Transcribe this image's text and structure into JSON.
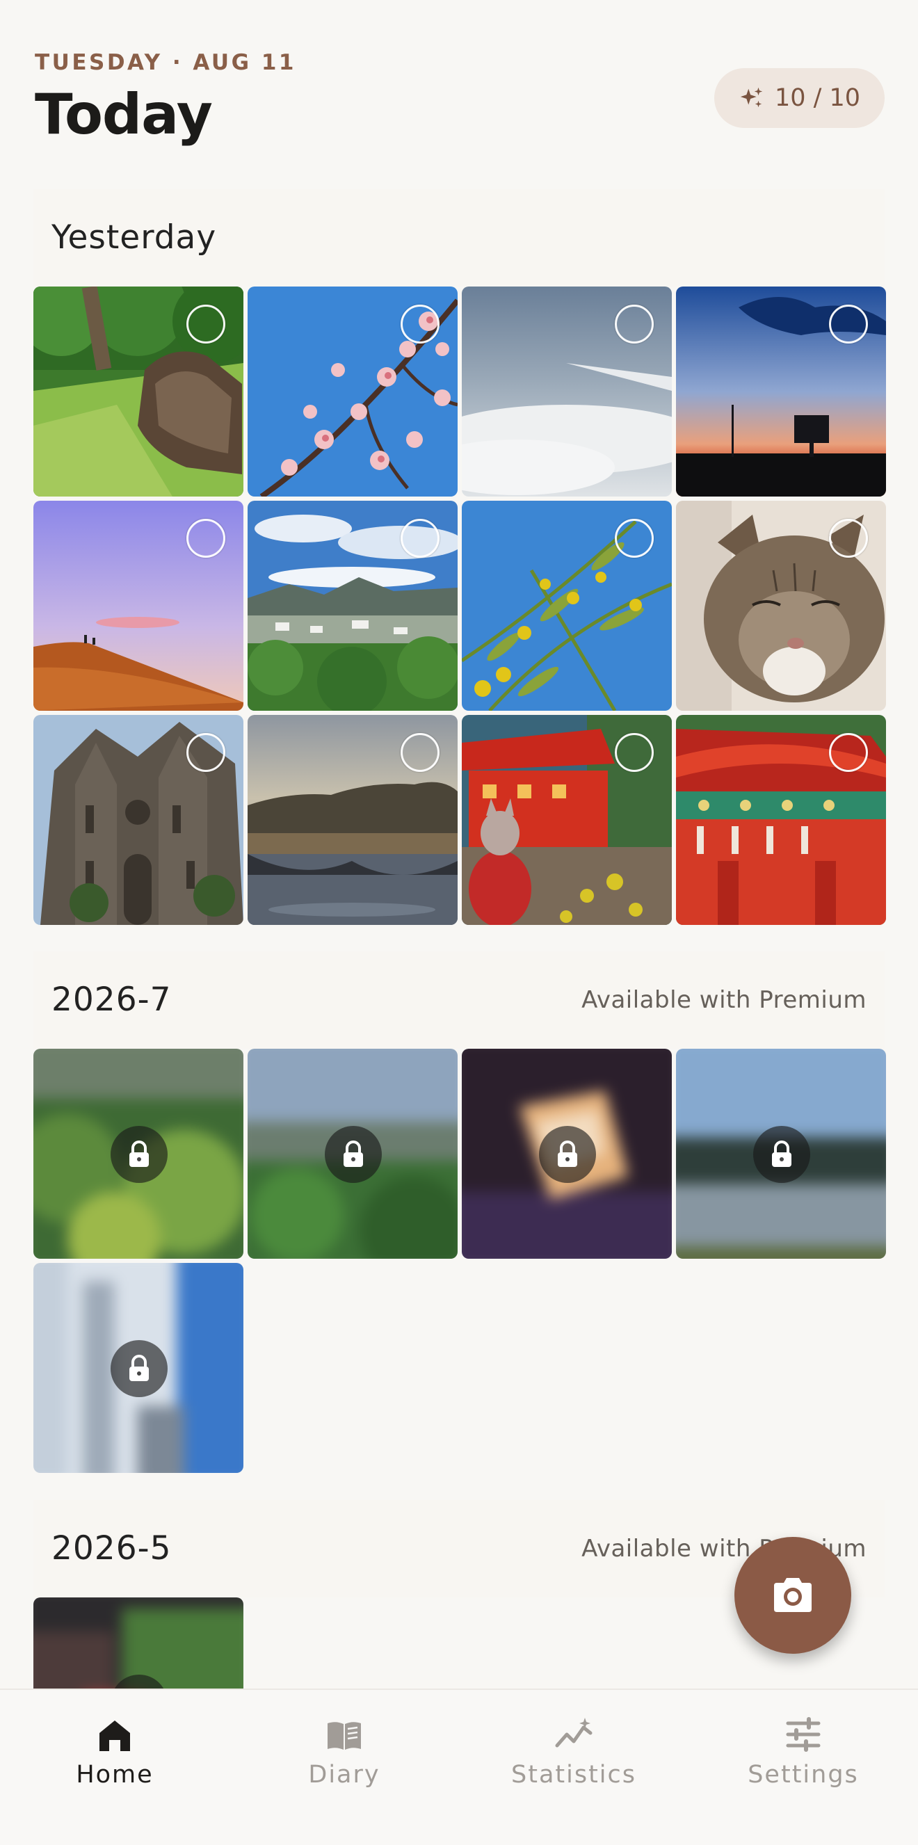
{
  "header": {
    "date": "TUESDAY · AUG 11",
    "title": "Today",
    "credits": "10 / 10",
    "credits_icon": "sparkle-icon"
  },
  "sections": [
    {
      "title": "Yesterday",
      "note": ""
    },
    {
      "title": "2026-7",
      "note": "Available with Premium"
    },
    {
      "title": "2026-5",
      "note": "Available with Premium"
    }
  ],
  "yesterday_photos": [
    "park-tree-stump",
    "cherry-blossom",
    "airplane-wing-clouds",
    "sunset-sky",
    "hill-silhouette",
    "town-valley",
    "yellow-flowers",
    "tabby-cat",
    "cathedral",
    "lake-reflection",
    "red-shrine-fox",
    "red-shrine-roof"
  ],
  "locked_photos_2026_7": [
    "lotus-leaves",
    "lotus-pond",
    "cake-slice",
    "lake-trees",
    "white-building"
  ],
  "locked_photos_2026_5": [
    "street-scene"
  ],
  "fab": {
    "icon": "camera-icon"
  },
  "nav": {
    "items": [
      {
        "label": "Home",
        "icon": "home-icon",
        "active": true
      },
      {
        "label": "Diary",
        "icon": "book-icon",
        "active": false
      },
      {
        "label": "Statistics",
        "icon": "chart-icon",
        "active": false
      },
      {
        "label": "Settings",
        "icon": "sliders-icon",
        "active": false
      }
    ]
  },
  "colors": {
    "accent": "#8b5a46",
    "background": "#f8f7f4",
    "chip": "#efe6df"
  }
}
